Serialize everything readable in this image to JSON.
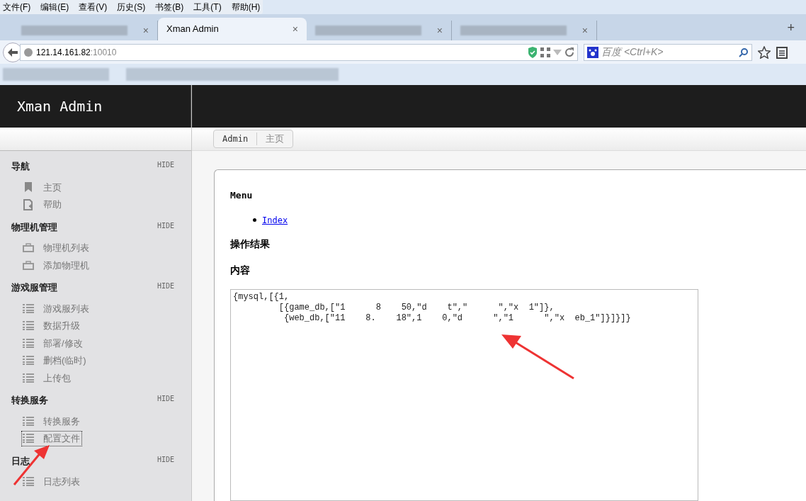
{
  "menu_bar": [
    "文件(F)",
    "编辑(E)",
    "查看(V)",
    "历史(S)",
    "书签(B)",
    "工具(T)",
    "帮助(H)"
  ],
  "tabs": [
    {
      "close": "×",
      "selected": false
    },
    {
      "title": "Xman Admin",
      "close": "×",
      "selected": true
    },
    {
      "close": "×",
      "selected": false
    },
    {
      "close": "×",
      "selected": false
    }
  ],
  "new_tab": "+",
  "address_bar": {
    "host": "121.14.161.82",
    "port": ":10010"
  },
  "search_bar": {
    "placeholder": "百度 <Ctrl+K>"
  },
  "header": {
    "title": "Xman Admin"
  },
  "breadcrumb": [
    "Admin",
    "主页"
  ],
  "sidebar": [
    {
      "title": "导航",
      "hide": "HIDE",
      "items": [
        {
          "label": "主页",
          "kind": "bookmark",
          "selected": false
        },
        {
          "label": "帮助",
          "kind": "doc",
          "selected": false
        }
      ]
    },
    {
      "title": "物理机管理",
      "hide": "HIDE",
      "items": [
        {
          "label": "物理机列表",
          "kind": "box",
          "selected": false
        },
        {
          "label": "添加物理机",
          "kind": "box",
          "selected": false
        }
      ]
    },
    {
      "title": "游戏服管理",
      "hide": "HIDE",
      "items": [
        {
          "label": "游戏服列表",
          "kind": "list",
          "selected": false
        },
        {
          "label": "数据升级",
          "kind": "list",
          "selected": false
        },
        {
          "label": "部署/修改",
          "kind": "list",
          "selected": false
        },
        {
          "label": "删档(临时)",
          "kind": "list",
          "selected": false
        },
        {
          "label": "上传包",
          "kind": "list",
          "selected": false
        }
      ]
    },
    {
      "title": "转换服务",
      "hide": "HIDE",
      "items": [
        {
          "label": "转换服务",
          "kind": "list",
          "selected": false
        },
        {
          "label": "配置文件",
          "kind": "list",
          "selected": true
        }
      ]
    },
    {
      "title": "日志",
      "hide": "HIDE",
      "items": [
        {
          "label": "日志列表",
          "kind": "list",
          "selected": false
        }
      ]
    }
  ],
  "content": {
    "menu_heading": "Menu",
    "links": [
      "Index"
    ],
    "result_heading": "操作结果",
    "content_heading": "内容",
    "text_lines": [
      "{mysql,[{1,",
      "         [{game_db,[\"1      8    50,\"d    t\",\"      \",\"x  1\"]},",
      "          {web_db,[\"11    8.    18\",1    0,\"d      \",\"1      \",\"x  eb_1\"]}]}]}"
    ]
  }
}
